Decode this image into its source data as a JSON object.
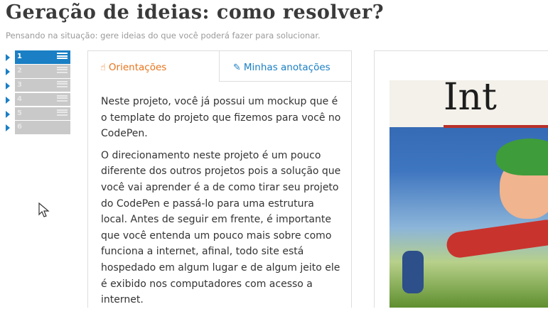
{
  "header": {
    "title": "Geração de ideias: como resolver?",
    "subtitle": "Pensando na situação: gere ideias do que você poderá fazer para solucionar."
  },
  "steps": [
    {
      "number": "1",
      "active": true
    },
    {
      "number": "2",
      "active": false
    },
    {
      "number": "3",
      "active": false
    },
    {
      "number": "4",
      "active": false
    },
    {
      "number": "5",
      "active": false
    },
    {
      "number": "6",
      "active": false
    }
  ],
  "tabs": {
    "orientacoes": {
      "label": "Orientações",
      "icon": "hand-pointer-icon"
    },
    "anotacoes": {
      "label": "Minhas anotações",
      "icon": "edit-icon"
    }
  },
  "content": {
    "paragraph1": "Neste projeto, você já possui um mockup que é o template do projeto que fizemos para você no CodePen.",
    "paragraph2": "O direcionamento neste projeto é um pouco diferente dos outros projetos pois a solução que você vai aprender é a de como tirar seu projeto do CodePen e passá-lo para uma estrutura local. Antes de seguir em frente, é importante que você entenda um pouco mais sobre como funciona a internet, afinal, todo site está hospedado em algum lugar e de algum jeito ele é exibido nos computadores com acesso a internet."
  },
  "preview": {
    "cover_title": "Int"
  },
  "colors": {
    "accent_blue": "#1a7fc4",
    "accent_orange": "#e8741b"
  }
}
